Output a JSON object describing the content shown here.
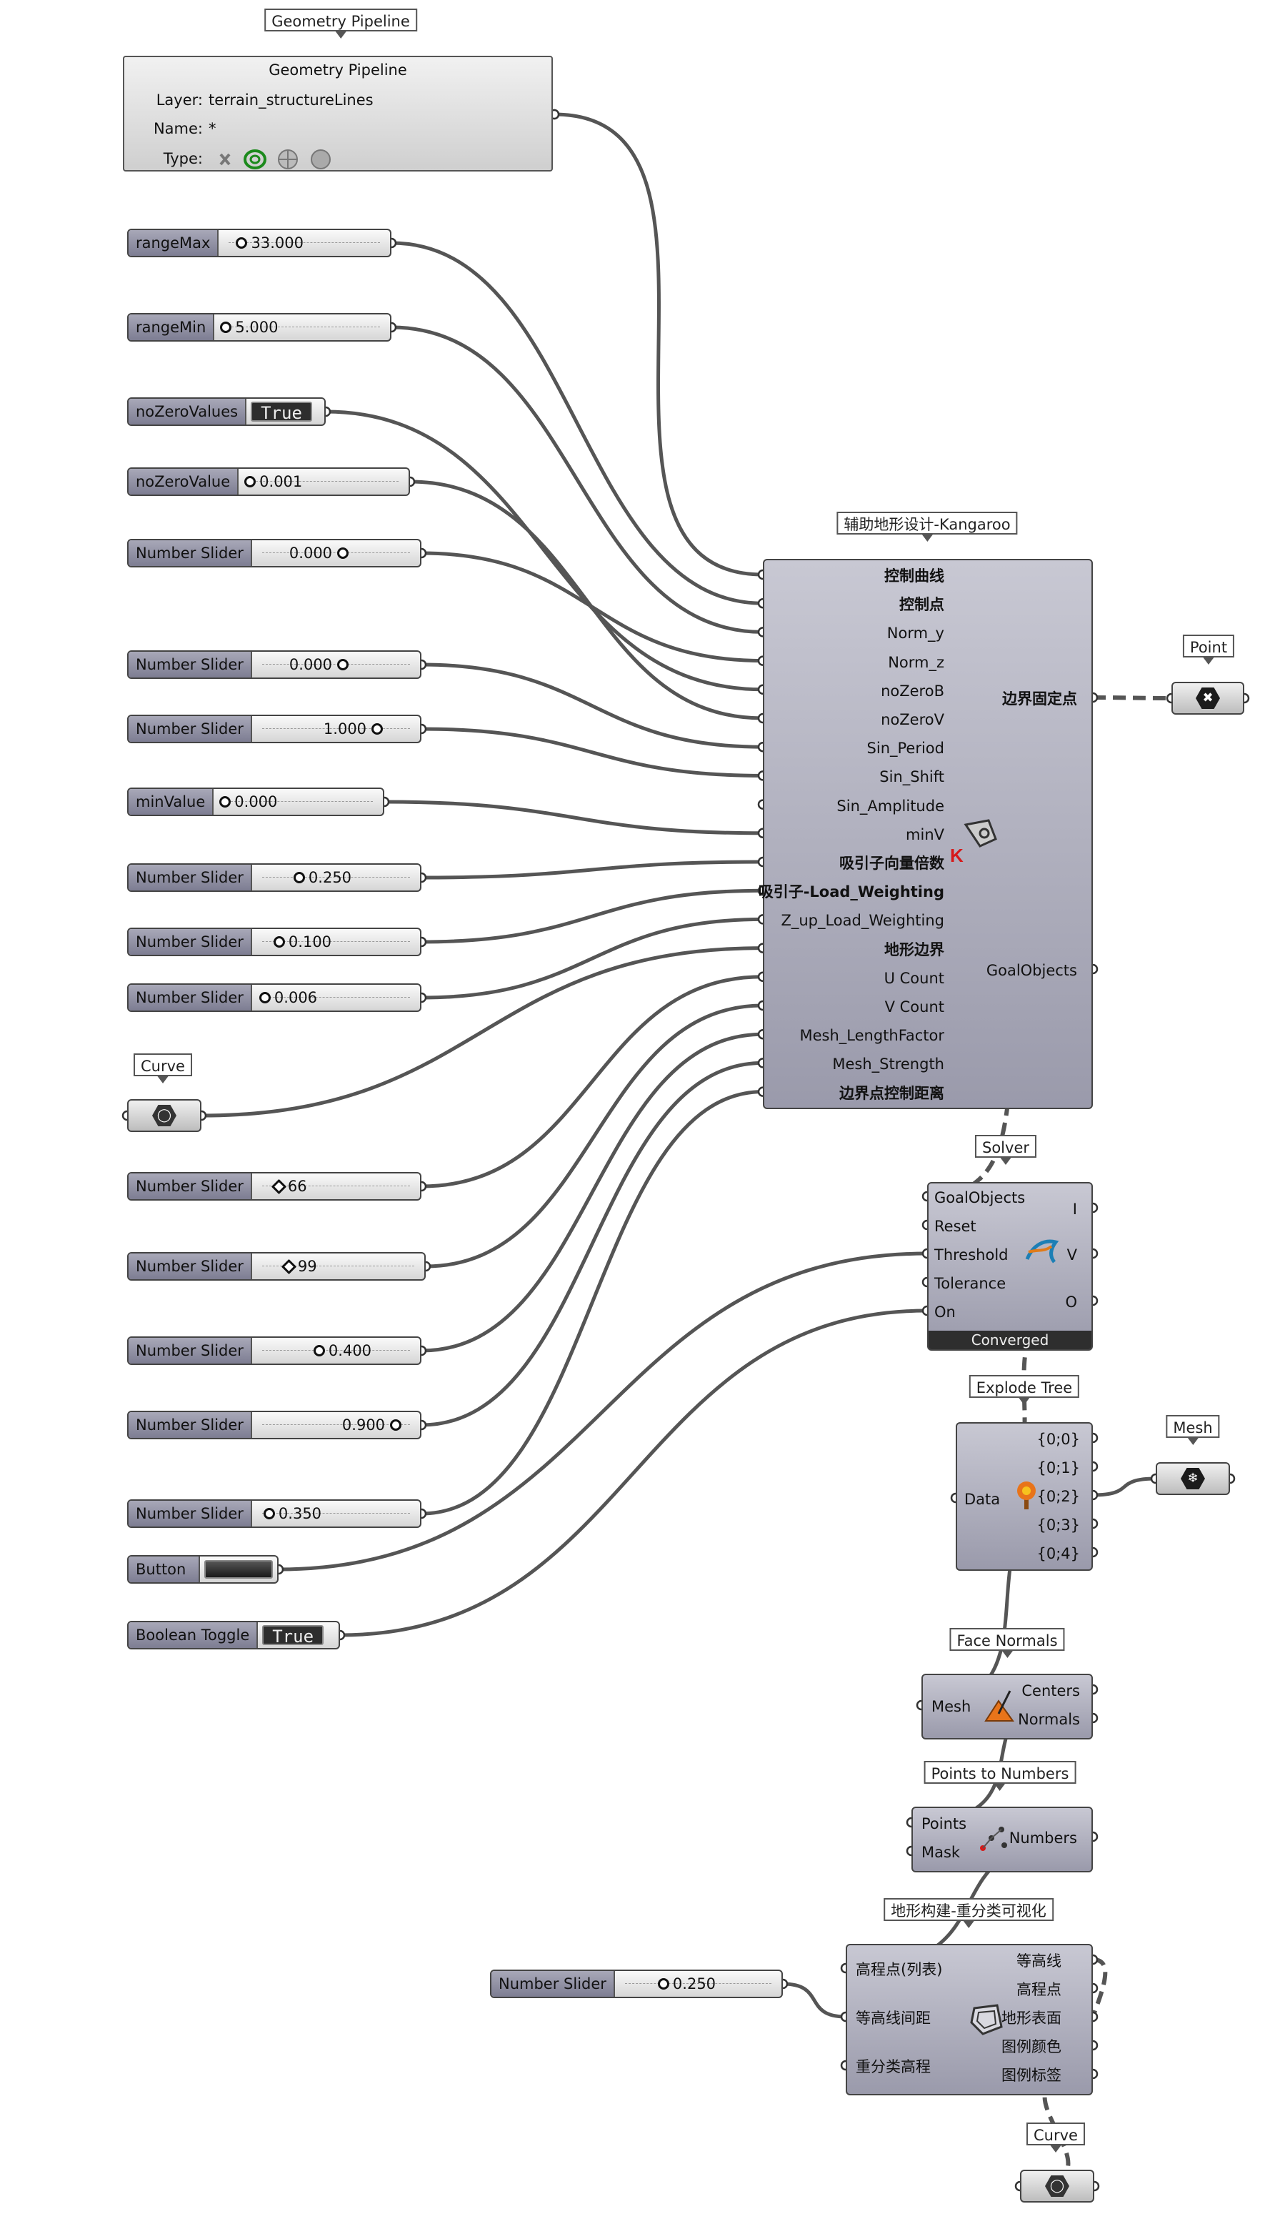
{
  "geometry_pipeline": {
    "bubble": "Geometry Pipeline",
    "title": "Geometry Pipeline",
    "layer_key": "Layer:",
    "layer_value": "terrain_structureLines",
    "name_key": "Name:",
    "name_value": "*",
    "type_key": "Type:"
  },
  "sliders": [
    {
      "label": "rangeMax",
      "value": "33.000"
    },
    {
      "label": "rangeMin",
      "value": "5.000"
    },
    {
      "label": "noZeroValues",
      "value": "True"
    },
    {
      "label": "noZeroValue",
      "value": "0.001"
    },
    {
      "label": "Number Slider",
      "value": "0.000"
    },
    {
      "label": "Number Slider",
      "value": "0.000"
    },
    {
      "label": "Number Slider",
      "value": "1.000"
    },
    {
      "label": "minValue",
      "value": "0.000"
    },
    {
      "label": "Number Slider",
      "value": "0.250"
    },
    {
      "label": "Number Slider",
      "value": "0.100"
    },
    {
      "label": "Number Slider",
      "value": "0.006"
    },
    {
      "label": "Number Slider",
      "value": "66"
    },
    {
      "label": "Number Slider",
      "value": "99"
    },
    {
      "label": "Number Slider",
      "value": "0.400"
    },
    {
      "label": "Number Slider",
      "value": "0.900"
    },
    {
      "label": "Number Slider",
      "value": "0.350"
    },
    {
      "label": "Button",
      "value": ""
    },
    {
      "label": "Boolean Toggle",
      "value": "True"
    },
    {
      "label": "Number Slider",
      "value": "0.250"
    }
  ],
  "curve_param": {
    "bubble": "Curve"
  },
  "curve_param_bottom": {
    "bubble": "Curve"
  },
  "point_param": {
    "bubble": "Point"
  },
  "mesh_param": {
    "bubble": "Mesh"
  },
  "kangaroo": {
    "bubble": "辅助地形设计-Kangaroo",
    "inputs": [
      "控制曲线",
      "控制点",
      "Norm_y",
      "Norm_z",
      "noZeroB",
      "noZeroV",
      "Sin_Period",
      "Sin_Shift",
      "Sin_Amplitude",
      "minV",
      "吸引子向量倍数",
      "吸引子-Load_Weighting",
      "Z_up_Load_Weighting",
      "地形边界",
      "U Count",
      "V Count",
      "Mesh_LengthFactor",
      "Mesh_Strength",
      "边界点控制距离"
    ],
    "outputs": [
      "边界固定点",
      "GoalObjects"
    ]
  },
  "solver": {
    "bubble": "Solver",
    "inputs": [
      "GoalObjects",
      "Reset",
      "Threshold",
      "Tolerance",
      "On"
    ],
    "outputs": [
      "I",
      "V",
      "O"
    ],
    "status": "Converged"
  },
  "explode_tree": {
    "bubble": "Explode Tree",
    "inputs": [
      "Data"
    ],
    "outputs": [
      "{0;0}",
      "{0;1}",
      "{0;2}",
      "{0;3}",
      "{0;4}"
    ]
  },
  "face_normals": {
    "bubble": "Face Normals",
    "inputs": [
      "Mesh"
    ],
    "outputs": [
      "Centers",
      "Normals"
    ]
  },
  "points_to_numbers": {
    "bubble": "Points to Numbers",
    "inputs": [
      "Points",
      "Mask"
    ],
    "outputs": [
      "Numbers"
    ]
  },
  "terrain": {
    "bubble": "地形构建-重分类可视化",
    "inputs": [
      "高程点(列表)",
      "等高线间距",
      "重分类高程"
    ],
    "outputs": [
      "等高线",
      "高程点",
      "地形表面",
      "图例颜色",
      "图例标签"
    ]
  },
  "colors": {
    "wire": "#555555",
    "node_fill": "#a9a9b8",
    "dark": "#2e2e2e"
  },
  "icons": {
    "kangaroo": "kangaroo-k-icon",
    "solver": "kangaroo-icon",
    "explode": "tree-icon",
    "normals": "face-normals-icon",
    "p2n": "points-to-numbers-icon",
    "terrain": "terrain-icon",
    "curve": "curve-param-icon",
    "point": "point-param-icon",
    "mesh": "mesh-param-icon"
  }
}
